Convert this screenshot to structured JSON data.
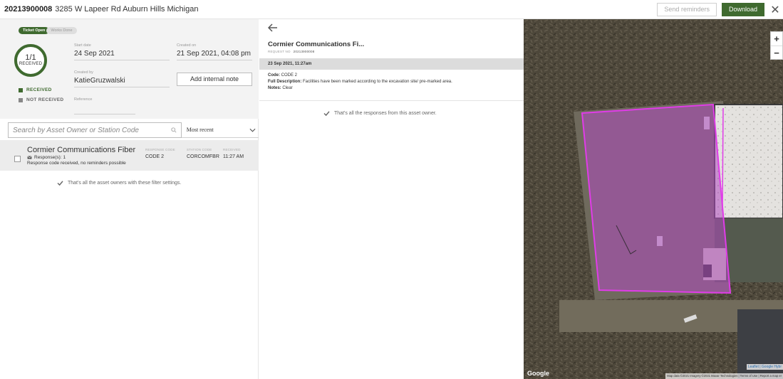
{
  "header": {
    "ticket_number": "20213900008",
    "address": "3285 W Lapeer Rd Auburn Hills Michigan",
    "send_reminders_label": "Send reminders",
    "download_label": "Download",
    "close_glyph": "✕"
  },
  "summary": {
    "tab_open": "Ticket Open",
    "tab_works_done": "Works Done",
    "progress_fraction": "1/1",
    "progress_label": "RECEIVED",
    "progress_value": 1.0,
    "legend_received": "RECEIVED",
    "legend_not_received": "NOT RECEIVED",
    "start_date_label": "Start date",
    "start_date_value": "24 Sep 2021",
    "created_on_label": "Created on",
    "created_on_value": "21 Sep 2021, 04:08 pm",
    "created_by_label": "Created by",
    "created_by_value": "KatieGruzwalski",
    "reference_label": "Reference",
    "add_note_label": "Add internal note"
  },
  "search": {
    "placeholder": "Search by Asset Owner or Station Code",
    "sort_value": "Most recent"
  },
  "owners_list": {
    "columns": {
      "response_code": "RESPONSE CODE",
      "station_code": "STATION CODE",
      "received": "RECEIVED"
    },
    "rows": [
      {
        "name": "Cormier Communications Fiber",
        "responses": "Response(s): 1",
        "note": "Response code received, no reminders possible",
        "response_code": "CODE 2",
        "station_code": "CORCOMFBR",
        "received": "11:27 AM"
      }
    ],
    "end_message": "That's all the asset owners with these filter settings."
  },
  "detail": {
    "title": "Cormier Communications Fi...",
    "request_label": "REQUEST NO",
    "request_value": "20213900008",
    "date_time": "23 Sep 2021, 11:27am",
    "code_label": "Code:",
    "code_value": "CODE 2",
    "full_desc_label": "Full Description:",
    "full_desc_value": "Facilities have been marked according to the excavation site/ pre-marked area.",
    "notes_label": "Notes:",
    "notes_value": "Clear",
    "end_message": "That's all the responses from this asset owner."
  },
  "map": {
    "zoom_in": "+",
    "zoom_out": "−",
    "attribution_leaflet": "Leaflet | Google Hybr",
    "attribution_terms": "Map data ©2021 Imagery ©2021 Maxar Technologies | Terms of Use | Report a map er",
    "logo": "Google"
  },
  "colors": {
    "brand_green": "#3f6a2f",
    "polygon_stroke": "#e03ce8",
    "polygon_fill": "#b04ac0"
  }
}
